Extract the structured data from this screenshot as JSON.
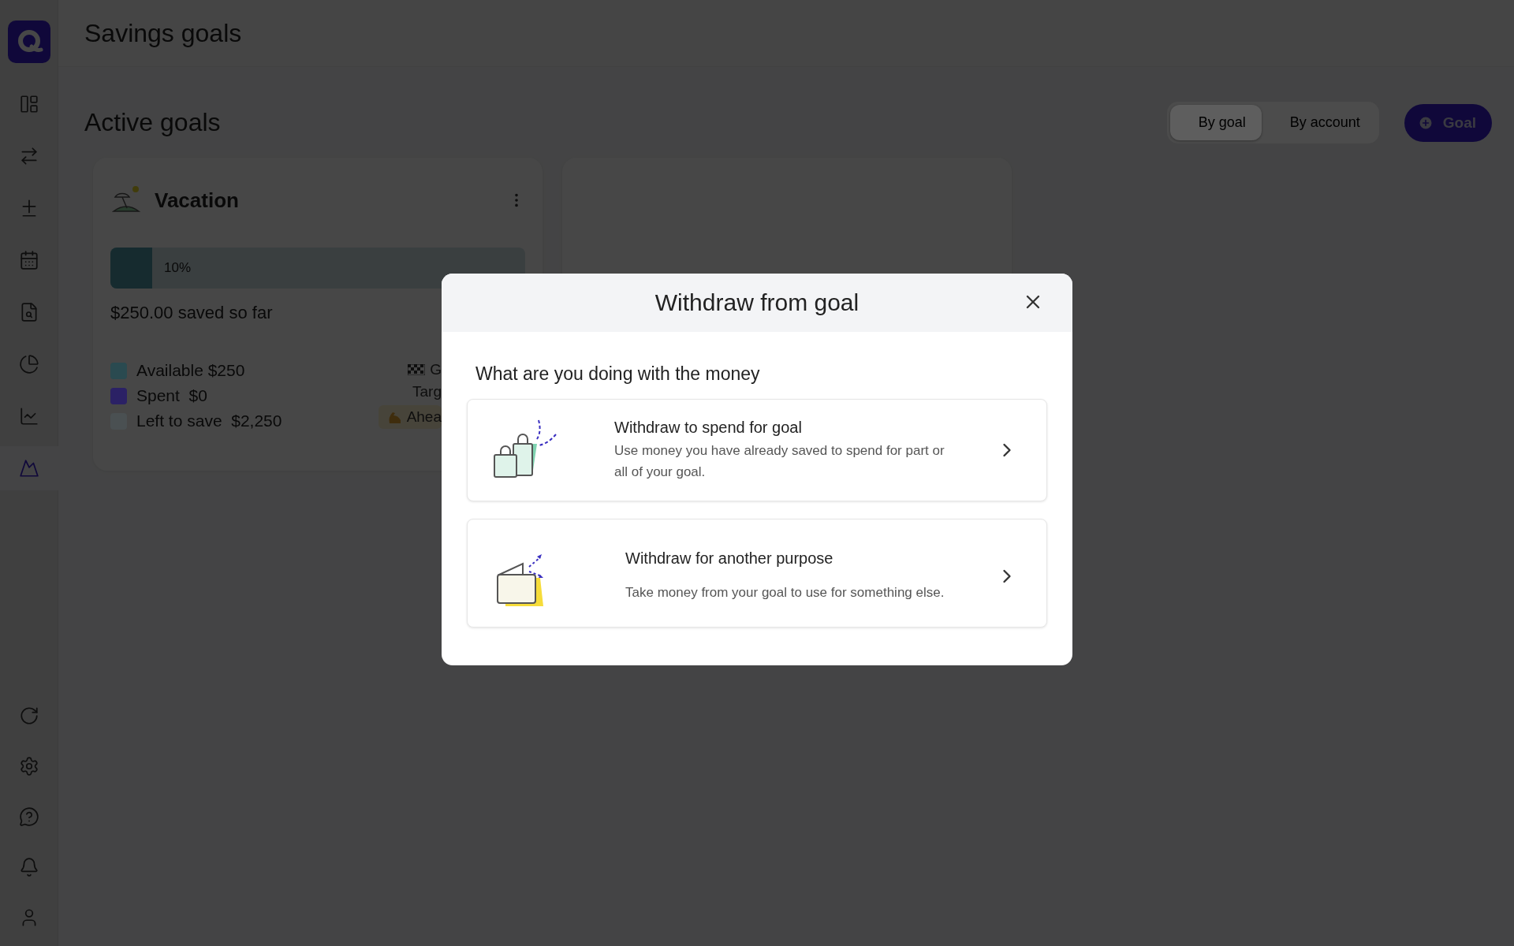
{
  "sidebar": {
    "nav": [
      {
        "kind": "dashboard",
        "selected": false
      },
      {
        "kind": "transactions",
        "selected": false
      },
      {
        "kind": "categories",
        "selected": false
      },
      {
        "kind": "calendar",
        "selected": false
      },
      {
        "kind": "reports",
        "selected": false
      },
      {
        "kind": "spending",
        "selected": false
      },
      {
        "kind": "investments",
        "selected": false
      },
      {
        "kind": "goals",
        "selected": true
      }
    ],
    "bottom": [
      {
        "kind": "sync"
      },
      {
        "kind": "settings"
      },
      {
        "kind": "help"
      },
      {
        "kind": "notifications"
      },
      {
        "kind": "profile"
      }
    ]
  },
  "header": {
    "title": "Savings goals"
  },
  "section": {
    "title": "Active goals",
    "view_toggle": [
      {
        "label": "By goal",
        "selected": true
      },
      {
        "label": "By account",
        "selected": false
      }
    ],
    "add_button": "Goal"
  },
  "goals": [
    {
      "name": "Vacation",
      "progress": {
        "level": 0.1,
        "label": "10%"
      },
      "saved": "$250.00 saved so far",
      "legend": [
        {
          "label": "Available $250",
          "color": "#2a4a50"
        },
        {
          "label": "Spent  $0",
          "color": "#2b2165"
        },
        {
          "label": "Left to save  $2,250",
          "color": "#4a5052"
        }
      ],
      "side": [
        {
          "kind": "flag",
          "text": "G"
        },
        {
          "kind": "plain",
          "text": "Targ"
        },
        {
          "kind": "pill",
          "text": "Ahea"
        }
      ]
    }
  ],
  "dialog": {
    "title": "Withdraw from goal",
    "question": "What are you doing with the money",
    "options": [
      {
        "kind": "spend",
        "title": "Withdraw to spend for goal",
        "description": "Use money you have already saved to spend for part or all of your goal."
      },
      {
        "kind": "other",
        "title": "Withdraw for another purpose",
        "description": "Take money from your goal to use for something else."
      }
    ]
  }
}
